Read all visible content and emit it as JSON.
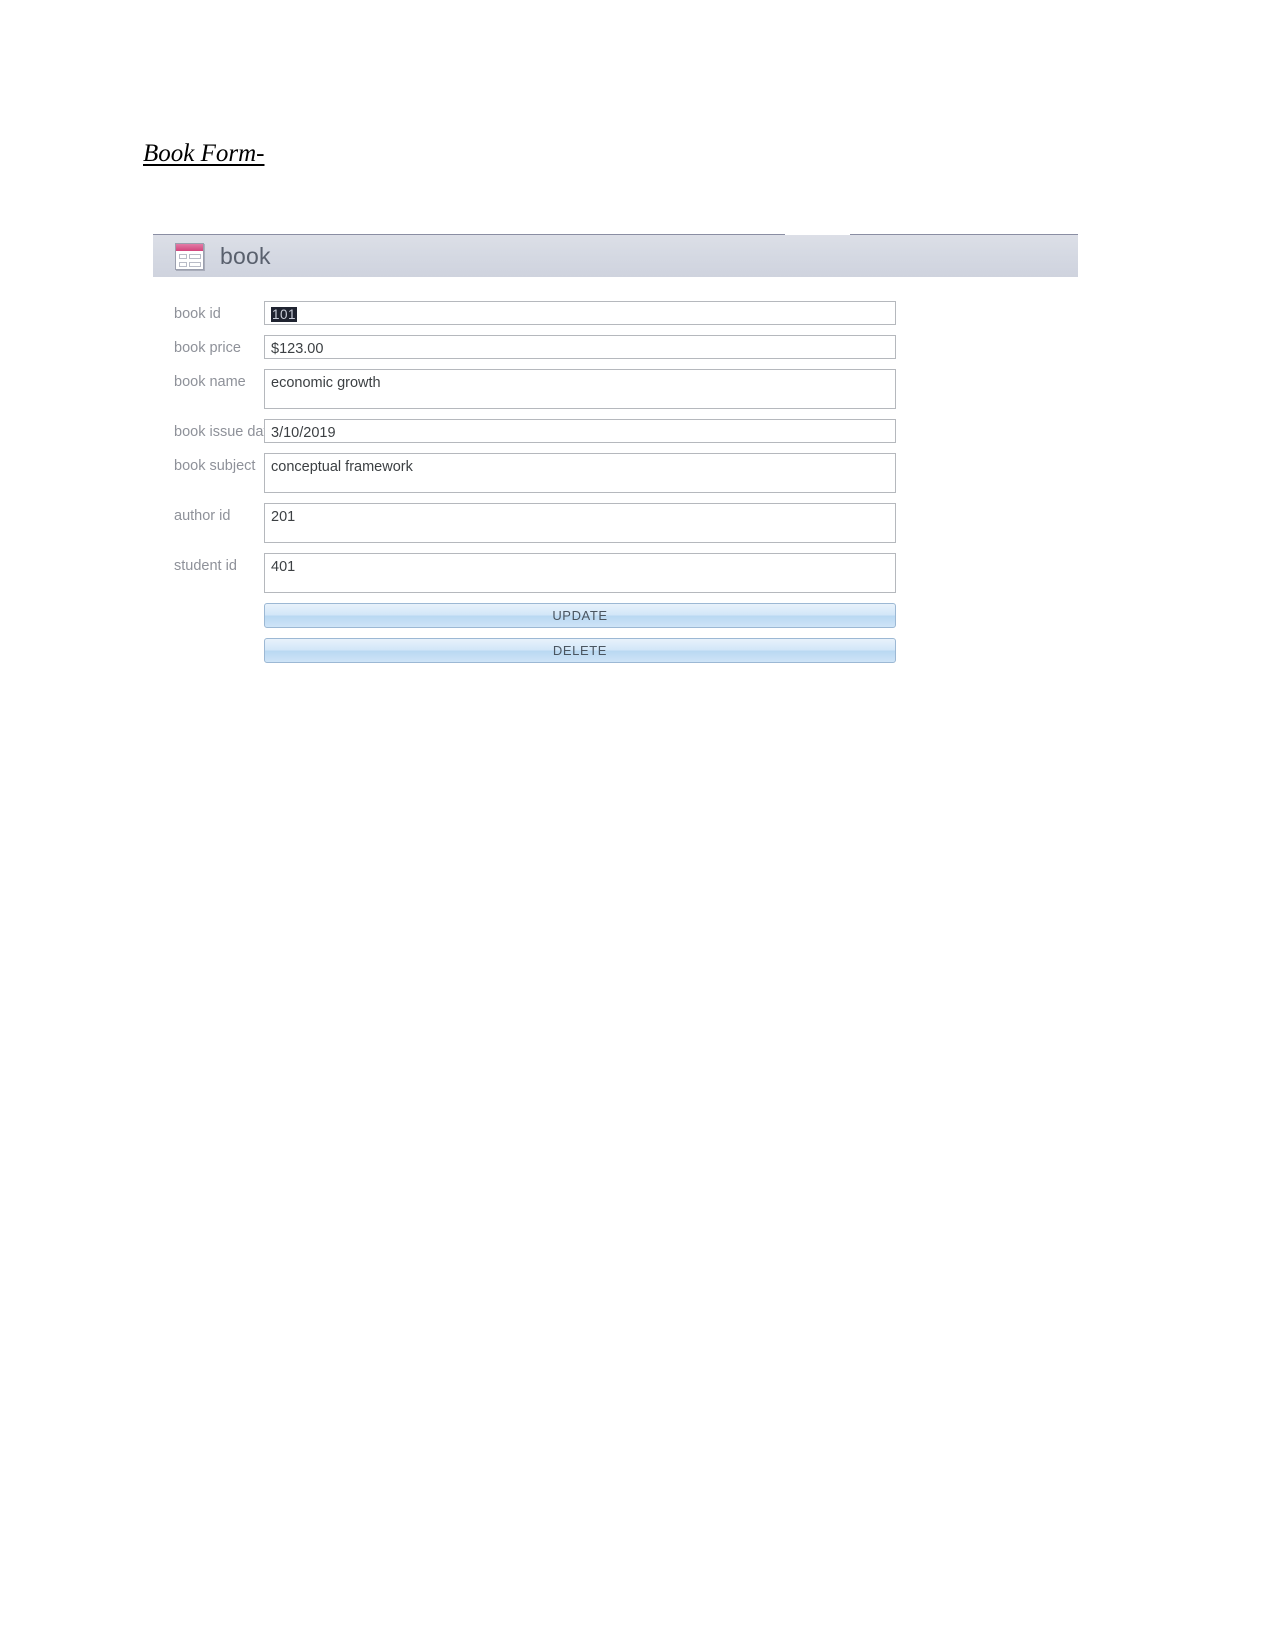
{
  "document": {
    "heading": "Book Form-"
  },
  "form": {
    "icon_name": "access-form-icon",
    "title": "book",
    "fields": [
      {
        "label": "book id",
        "value": "101",
        "selected": true,
        "size": "h1"
      },
      {
        "label": "book price",
        "value": "$123.00",
        "selected": false,
        "size": "h1"
      },
      {
        "label": "book name",
        "value": "economic growth",
        "selected": false,
        "size": "h2"
      },
      {
        "label": "book issue date",
        "value": "3/10/2019",
        "selected": false,
        "size": "h1"
      },
      {
        "label": "book subject",
        "value": "conceptual framework",
        "selected": false,
        "size": "h2"
      },
      {
        "label": "author id",
        "value": "201",
        "selected": false,
        "size": "h2"
      },
      {
        "label": "student id",
        "value": "401",
        "selected": false,
        "size": "h2"
      }
    ],
    "buttons": [
      {
        "label": "UPDATE"
      },
      {
        "label": "DELETE"
      }
    ]
  },
  "colors": {
    "header_bar": "#d4d8e2",
    "header_title_text": "#59606d",
    "label_text": "#8e9199",
    "value_text": "#3c4043",
    "field_border": "#b5b8bd",
    "button_fill": "#cfe4f7",
    "button_border": "#9cb8d4",
    "button_text": "#4a5560",
    "icon_accent": "#d2447c",
    "selection_bg": "#1f2330"
  }
}
